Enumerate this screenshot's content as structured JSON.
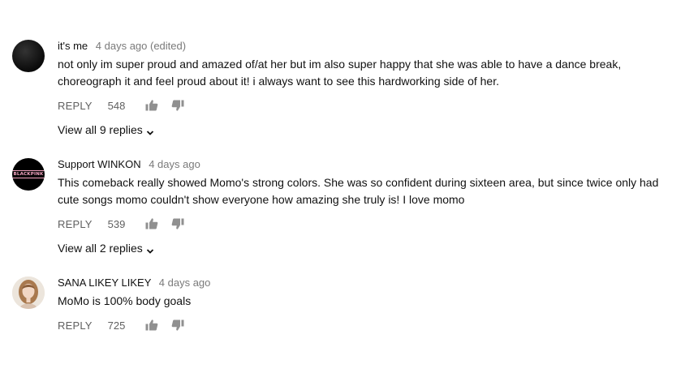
{
  "comments": [
    {
      "author": "it's me",
      "time": "4 days ago (edited)",
      "text": "not only im super proud and amazed of/at her but im also super happy that she was able to have a dance break, choreograph it and feel proud about it! i always want to see this hardworking side of her.",
      "reply_label": "REPLY",
      "likes": "548",
      "view_replies": "View all 9 replies",
      "avatar_style": "dark-circle"
    },
    {
      "author": "Support WINKON",
      "time": "4 days ago",
      "text": "This comeback really showed Momo's strong colors. She was so confident during sixteen area, but since twice only had cute songs momo couldn't show everyone how amazing she truly is! I love momo",
      "reply_label": "REPLY",
      "likes": "539",
      "view_replies": "View all 2 replies",
      "avatar_logo_text": "BLACKPINK",
      "avatar_style": "black-logo"
    },
    {
      "author": "SANA LIKEY LIKEY",
      "time": "4 days ago",
      "text": "MoMo is 100% body goals",
      "reply_label": "REPLY",
      "likes": "725",
      "avatar_style": "photo"
    }
  ],
  "icons": {
    "like": "thumbs-up-icon",
    "dislike": "thumbs-down-icon",
    "expand": "chevron-down-icon"
  },
  "colors": {
    "text": "#111111",
    "meta": "#606060",
    "icon": "#909090",
    "logo_pink": "#f7a7c3"
  }
}
